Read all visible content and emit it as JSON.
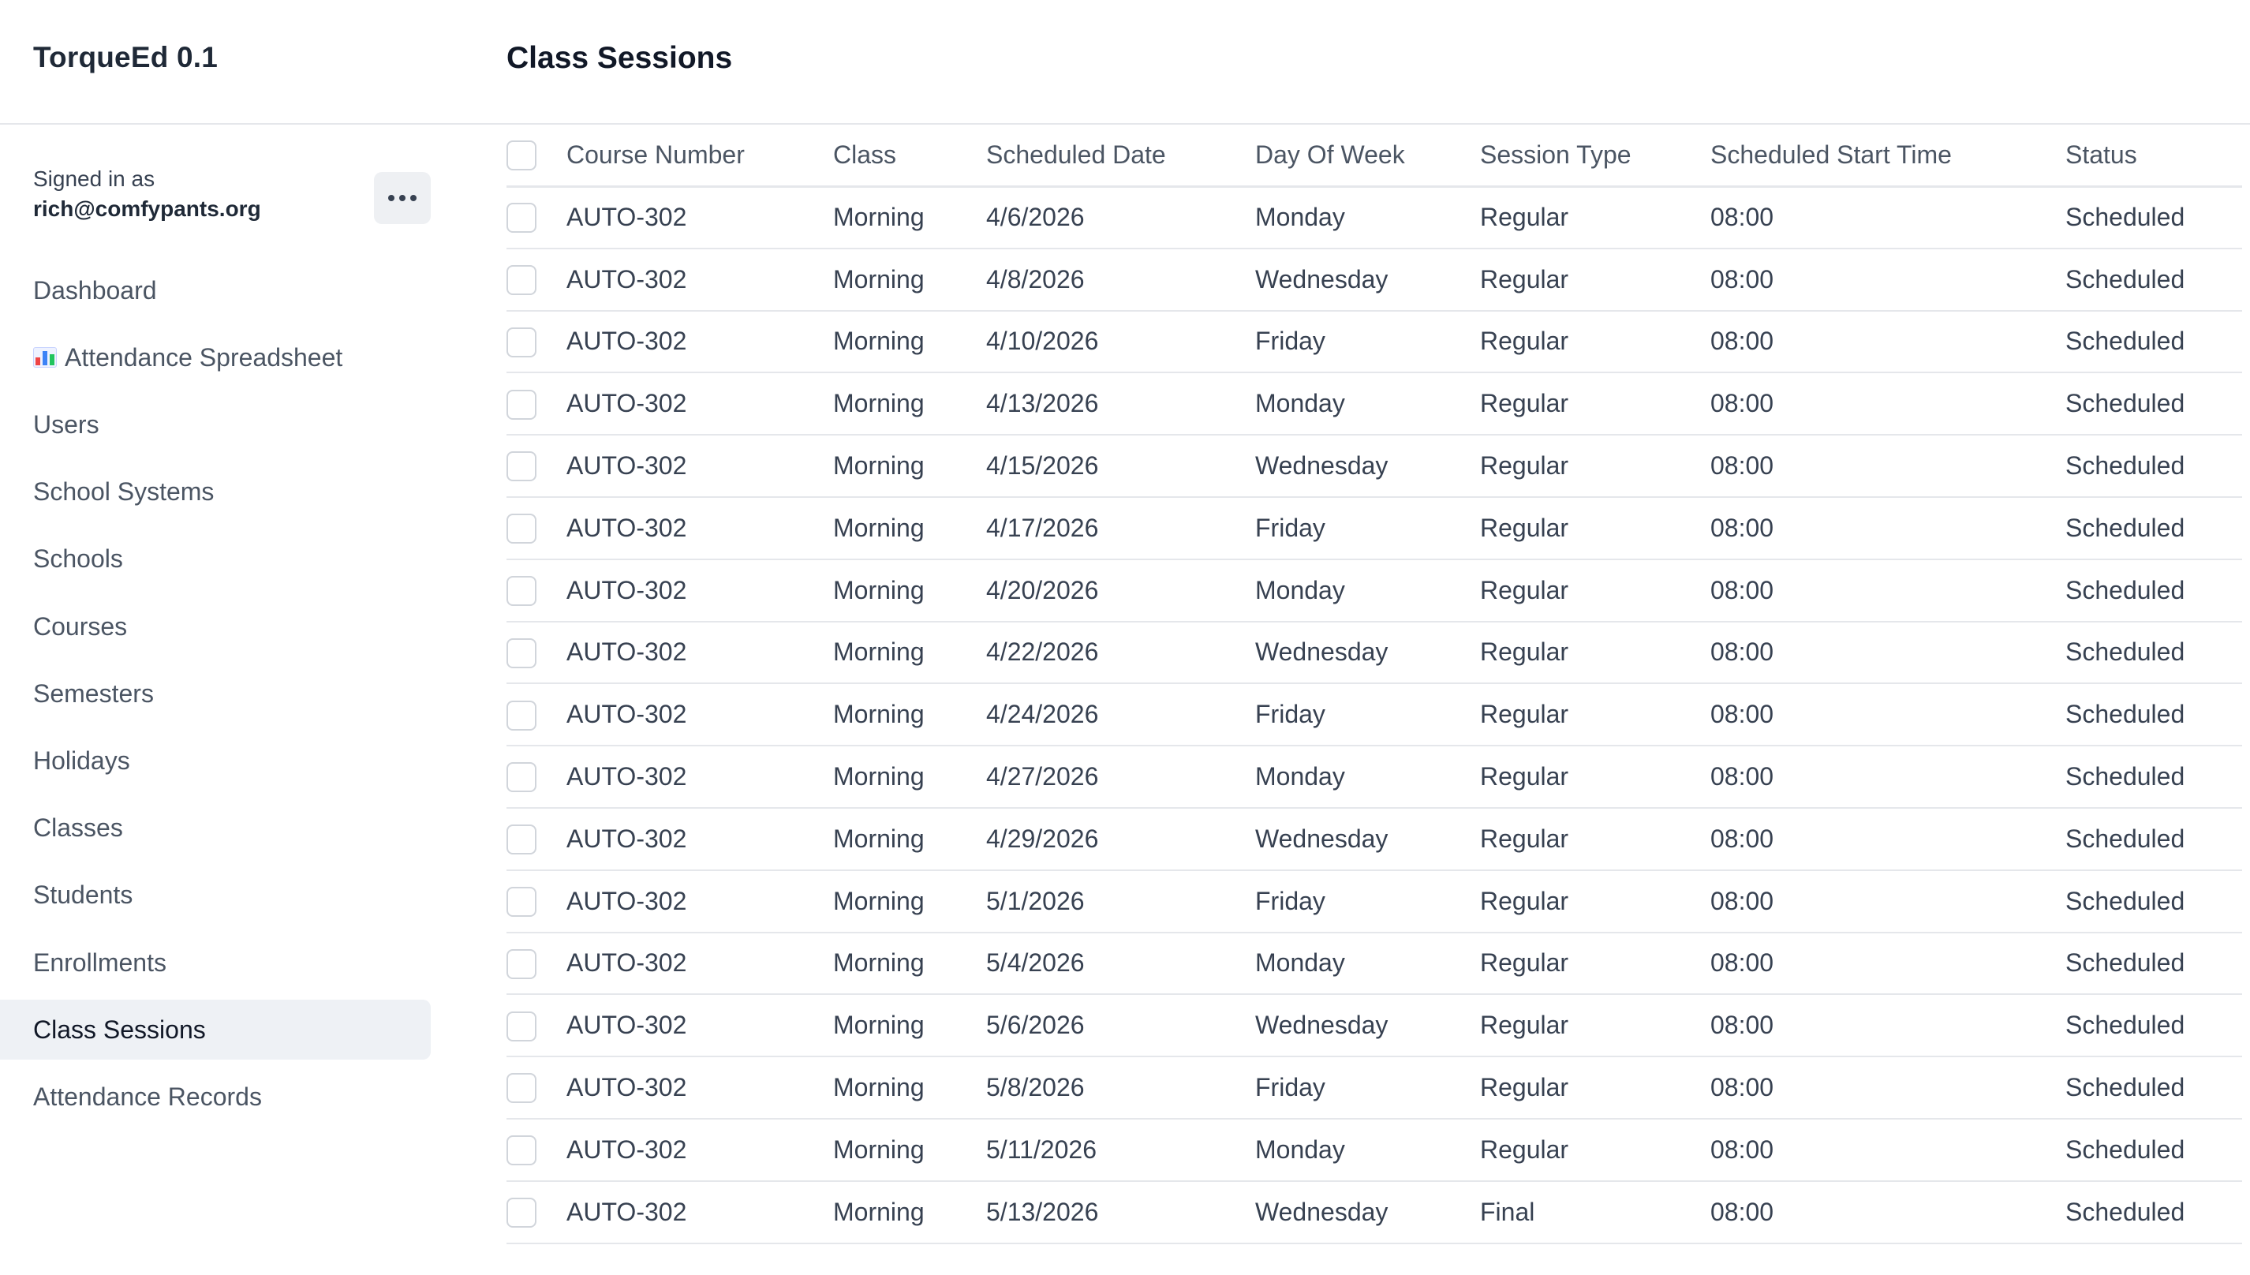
{
  "app": {
    "title": "TorqueEd 0.1"
  },
  "page": {
    "title": "Class Sessions"
  },
  "account": {
    "signed_in_label": "Signed in as",
    "email": "rich@comfypants.org"
  },
  "sidebar": {
    "items": [
      {
        "label": "Dashboard",
        "icon": null,
        "active": false
      },
      {
        "label": "Attendance Spreadsheet",
        "icon": "bar-chart-icon",
        "active": false
      },
      {
        "label": "Users",
        "icon": null,
        "active": false
      },
      {
        "label": "School Systems",
        "icon": null,
        "active": false
      },
      {
        "label": "Schools",
        "icon": null,
        "active": false
      },
      {
        "label": "Courses",
        "icon": null,
        "active": false
      },
      {
        "label": "Semesters",
        "icon": null,
        "active": false
      },
      {
        "label": "Holidays",
        "icon": null,
        "active": false
      },
      {
        "label": "Classes",
        "icon": null,
        "active": false
      },
      {
        "label": "Students",
        "icon": null,
        "active": false
      },
      {
        "label": "Enrollments",
        "icon": null,
        "active": false
      },
      {
        "label": "Class Sessions",
        "icon": null,
        "active": true
      },
      {
        "label": "Attendance Records",
        "icon": null,
        "active": false
      }
    ]
  },
  "table": {
    "columns": [
      "Course Number",
      "Class",
      "Scheduled Date",
      "Day Of Week",
      "Session Type",
      "Scheduled Start Time",
      "Status"
    ],
    "rows": [
      [
        "AUTO-302",
        "Morning",
        "4/6/2026",
        "Monday",
        "Regular",
        "08:00",
        "Scheduled"
      ],
      [
        "AUTO-302",
        "Morning",
        "4/8/2026",
        "Wednesday",
        "Regular",
        "08:00",
        "Scheduled"
      ],
      [
        "AUTO-302",
        "Morning",
        "4/10/2026",
        "Friday",
        "Regular",
        "08:00",
        "Scheduled"
      ],
      [
        "AUTO-302",
        "Morning",
        "4/13/2026",
        "Monday",
        "Regular",
        "08:00",
        "Scheduled"
      ],
      [
        "AUTO-302",
        "Morning",
        "4/15/2026",
        "Wednesday",
        "Regular",
        "08:00",
        "Scheduled"
      ],
      [
        "AUTO-302",
        "Morning",
        "4/17/2026",
        "Friday",
        "Regular",
        "08:00",
        "Scheduled"
      ],
      [
        "AUTO-302",
        "Morning",
        "4/20/2026",
        "Monday",
        "Regular",
        "08:00",
        "Scheduled"
      ],
      [
        "AUTO-302",
        "Morning",
        "4/22/2026",
        "Wednesday",
        "Regular",
        "08:00",
        "Scheduled"
      ],
      [
        "AUTO-302",
        "Morning",
        "4/24/2026",
        "Friday",
        "Regular",
        "08:00",
        "Scheduled"
      ],
      [
        "AUTO-302",
        "Morning",
        "4/27/2026",
        "Monday",
        "Regular",
        "08:00",
        "Scheduled"
      ],
      [
        "AUTO-302",
        "Morning",
        "4/29/2026",
        "Wednesday",
        "Regular",
        "08:00",
        "Scheduled"
      ],
      [
        "AUTO-302",
        "Morning",
        "5/1/2026",
        "Friday",
        "Regular",
        "08:00",
        "Scheduled"
      ],
      [
        "AUTO-302",
        "Morning",
        "5/4/2026",
        "Monday",
        "Regular",
        "08:00",
        "Scheduled"
      ],
      [
        "AUTO-302",
        "Morning",
        "5/6/2026",
        "Wednesday",
        "Regular",
        "08:00",
        "Scheduled"
      ],
      [
        "AUTO-302",
        "Morning",
        "5/8/2026",
        "Friday",
        "Regular",
        "08:00",
        "Scheduled"
      ],
      [
        "AUTO-302",
        "Morning",
        "5/11/2026",
        "Monday",
        "Regular",
        "08:00",
        "Scheduled"
      ],
      [
        "AUTO-302",
        "Morning",
        "5/13/2026",
        "Wednesday",
        "Final",
        "08:00",
        "Scheduled"
      ]
    ]
  }
}
